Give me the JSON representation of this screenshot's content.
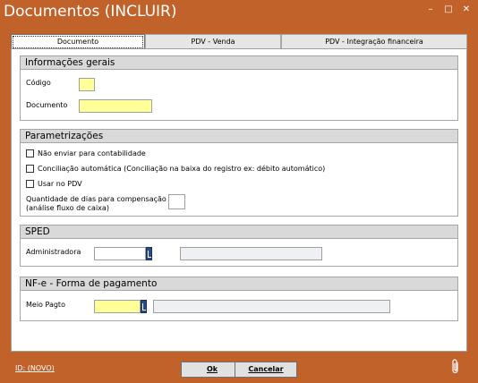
{
  "window": {
    "title": "Documentos (INCLUIR)"
  },
  "tabs": [
    {
      "label": "Documento"
    },
    {
      "label": "PDV - Venda"
    },
    {
      "label": "PDV - Integração financeira"
    }
  ],
  "informacoes_gerais": {
    "header": "Informações gerais",
    "codigo_label": "Código",
    "codigo_value": "",
    "documento_label": "Documento",
    "documento_value": ""
  },
  "parametrizacoes": {
    "header": "Parametrizações",
    "nao_enviar_label": "Não enviar para contabilidade",
    "nao_enviar_checked": false,
    "conciliacao_label": "Conciliação automática (Conciliação na baixa do registro ex: débito automático)",
    "conciliacao_checked": false,
    "usar_pdv_label": "Usar no PDV",
    "usar_pdv_checked": false,
    "dias_compensacao_label_1": "Quantidade de dias para compensação",
    "dias_compensacao_label_2": "(análise fluxo de caixa)",
    "dias_compensacao_value": ""
  },
  "sped": {
    "header": "SPED",
    "administradora_label": "Administradora",
    "administradora_code": "",
    "administradora_desc": ""
  },
  "nfe": {
    "header": "NF-e - Forma de pagamento",
    "meio_pagto_label": "Meio Pagto",
    "meio_pagto_code": "",
    "meio_pagto_desc": ""
  },
  "footer": {
    "id_label": "ID: (NOVO)",
    "ok_label": "Ok",
    "cancel_label": "Cancelar"
  },
  "colors": {
    "accent": "#c1622b",
    "required_field": "#ffff99",
    "group_header": "#d9d9d9"
  },
  "icons": [
    "minimize-icon",
    "maximize-icon",
    "close-icon",
    "paperclip-icon",
    "lookup-icon"
  ]
}
